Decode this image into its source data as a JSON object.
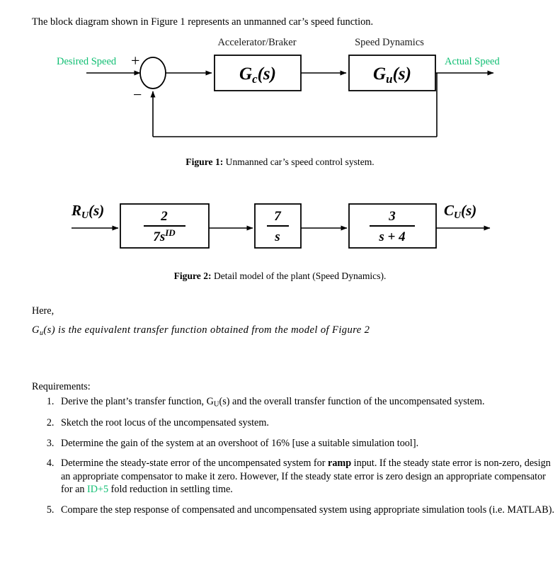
{
  "document": {
    "intro": "The block diagram shown in Figure 1 represents an unmanned car’s speed function.",
    "here_label": "Here,",
    "here_statement_prefix": "G",
    "here_statement_sub": "u",
    "here_statement_rest": "(s) is the equivalent transfer function obtained from the model of Figure 2",
    "requirements_heading": "Requirements:"
  },
  "figure1": {
    "caption_label": "Figure 1:",
    "caption_text": " Unmanned car’s speed control system.",
    "input_label": "Desired Speed",
    "output_label": "Actual Speed",
    "plus_sign": "+",
    "minus_sign": "−",
    "block1_title": "Accelerator/Braker",
    "block2_title": "Speed Dynamics",
    "block1_text": "G",
    "block1_sub": "c",
    "block1_tail": "(s)",
    "block2_text": "G",
    "block2_sub": "u",
    "block2_tail": "(s)",
    "green_hex": "#0FBE72"
  },
  "figure2": {
    "caption_label": "Figure 2:",
    "caption_text": " Detail model of the plant (Speed Dynamics).",
    "input_label_main": "R",
    "input_label_sub": "U",
    "input_label_tail": "(s)",
    "output_label_main": "C",
    "output_label_sub": "U",
    "output_label_tail": "(s)",
    "blocks": [
      {
        "numerator": "2",
        "denominator": "7s",
        "denominator_sup": "ID"
      },
      {
        "numerator": "7",
        "denominator": "s",
        "denominator_sup": ""
      },
      {
        "numerator": "3",
        "denominator": "s + 4",
        "denominator_sup": ""
      }
    ]
  },
  "requirements": [
    {
      "id": 1,
      "parts": [
        {
          "t": "Derive the plant’s transfer function, G",
          "style": "normal"
        },
        {
          "t": "U",
          "style": "sub"
        },
        {
          "t": "(s) and the overall transfer function of the uncompensated system.",
          "style": "normal"
        }
      ]
    },
    {
      "id": 2,
      "parts": [
        {
          "t": "Sketch the root locus of the uncompensated system.",
          "style": "normal"
        }
      ]
    },
    {
      "id": 3,
      "parts": [
        {
          "t": "Determine the gain of the system at an overshoot of 16% [use a suitable simulation tool].",
          "style": "normal"
        }
      ]
    },
    {
      "id": 4,
      "parts": [
        {
          "t": "Determine the steady-state error of the uncompensated system for ",
          "style": "normal"
        },
        {
          "t": "ramp",
          "style": "bold"
        },
        {
          "t": " input. If the steady state error is non-zero, design an appropriate compensator to make it zero. However, If the steady state error is zero design an appropriate compensator for an ",
          "style": "normal"
        },
        {
          "t": "ID+5",
          "style": "green"
        },
        {
          "t": " fold reduction in settling time.",
          "style": "normal"
        }
      ]
    },
    {
      "id": 5,
      "parts": [
        {
          "t": "Compare the step response of compensated and uncompensated system using appropriate simulation tools (i.e. MATLAB).",
          "style": "normal"
        }
      ]
    }
  ]
}
